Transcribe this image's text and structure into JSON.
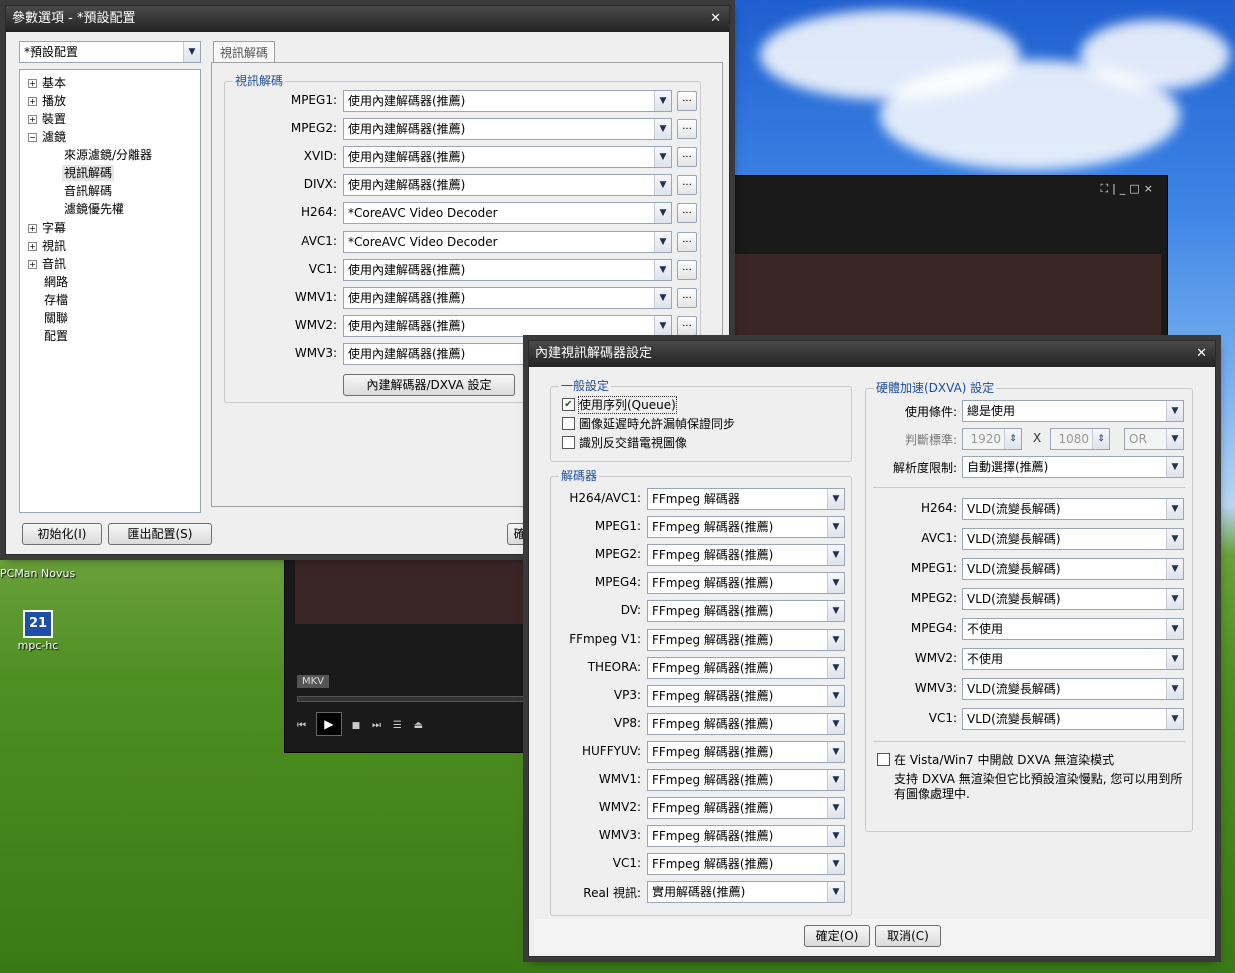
{
  "desktop": {
    "icons": [
      {
        "label": "PCMan Novus"
      },
      {
        "label": "mpc-hc"
      }
    ]
  },
  "options": {
    "title": "參數選項 - *預設配置",
    "profile": "*預設配置",
    "tree": [
      {
        "label": "基本",
        "expander": "+"
      },
      {
        "label": "播放",
        "expander": "+"
      },
      {
        "label": "裝置",
        "expander": "+"
      },
      {
        "label": "濾鏡",
        "expander": "−"
      },
      {
        "label": "來源濾鏡/分離器"
      },
      {
        "label": "視訊解碼"
      },
      {
        "label": "音訊解碼"
      },
      {
        "label": "濾鏡優先權"
      },
      {
        "label": "字幕",
        "expander": "+"
      },
      {
        "label": "視訊",
        "expander": "+"
      },
      {
        "label": "音訊",
        "expander": "+"
      },
      {
        "label": "網路"
      },
      {
        "label": "存檔"
      },
      {
        "label": "關聯"
      },
      {
        "label": "配置"
      }
    ],
    "tab": "視訊解碼",
    "group_title": "視訊解碼",
    "codecs": [
      {
        "label": "MPEG1:",
        "value": "使用內建解碼器(推薦)"
      },
      {
        "label": "MPEG2:",
        "value": "使用內建解碼器(推薦)"
      },
      {
        "label": "XVID:",
        "value": "使用內建解碼器(推薦)"
      },
      {
        "label": "DIVX:",
        "value": "使用內建解碼器(推薦)"
      },
      {
        "label": "H264:",
        "value": "*CoreAVC Video Decoder"
      },
      {
        "label": "AVC1:",
        "value": "*CoreAVC Video Decoder"
      },
      {
        "label": "VC1:",
        "value": "使用內建解碼器(推薦)"
      },
      {
        "label": "WMV1:",
        "value": "使用內建解碼器(推薦)"
      },
      {
        "label": "WMV2:",
        "value": "使用內建解碼器(推薦)"
      },
      {
        "label": "WMV3:",
        "value": "使用內建解碼器(推薦)"
      }
    ],
    "dots": "...",
    "dxva_button": "內建解碼器/DXVA 設定",
    "init_button": "初始化(I)",
    "export_button": "匯出配置(S)",
    "ok_button_partial": "確"
  },
  "player": {
    "format": "MKV",
    "controls": [
      "⏮",
      "▶",
      "■",
      "⏭",
      "☰",
      "⏏"
    ],
    "window_buttons": [
      "⛶",
      "|",
      "_",
      "□",
      "×"
    ]
  },
  "dialog": {
    "title": "內建視訊解碼器設定",
    "general_title": "一般設定",
    "checks": [
      {
        "label": "使用序列(Queue)",
        "checked": true
      },
      {
        "label": "圖像延遲時允許漏幀保證同步",
        "checked": false
      },
      {
        "label": "識別反交錯電視圖像",
        "checked": false
      }
    ],
    "decoders_title": "解碼器",
    "decoders": [
      {
        "label": "H264/AVC1:",
        "value": "FFmpeg 解碼器"
      },
      {
        "label": "MPEG1:",
        "value": "FFmpeg 解碼器(推薦)"
      },
      {
        "label": "MPEG2:",
        "value": "FFmpeg 解碼器(推薦)"
      },
      {
        "label": "MPEG4:",
        "value": "FFmpeg 解碼器(推薦)"
      },
      {
        "label": "DV:",
        "value": "FFmpeg 解碼器(推薦)"
      },
      {
        "label": "FFmpeg V1:",
        "value": "FFmpeg 解碼器(推薦)"
      },
      {
        "label": "THEORA:",
        "value": "FFmpeg 解碼器(推薦)"
      },
      {
        "label": "VP3:",
        "value": "FFmpeg 解碼器(推薦)"
      },
      {
        "label": "VP8:",
        "value": "FFmpeg 解碼器(推薦)"
      },
      {
        "label": "HUFFYUV:",
        "value": "FFmpeg 解碼器(推薦)"
      },
      {
        "label": "WMV1:",
        "value": "FFmpeg 解碼器(推薦)"
      },
      {
        "label": "WMV2:",
        "value": "FFmpeg 解碼器(推薦)"
      },
      {
        "label": "WMV3:",
        "value": "FFmpeg 解碼器(推薦)"
      },
      {
        "label": "VC1:",
        "value": "FFmpeg 解碼器(推薦)"
      },
      {
        "label": "Real 視訊:",
        "value": "實用解碼器(推薦)"
      }
    ],
    "hw_title": "硬體加速(DXVA) 設定",
    "usage_label": "使用條件:",
    "usage_value": "總是使用",
    "criteria_label": "判斷標準:",
    "width": "1920",
    "x_label": "X",
    "height": "1080",
    "op": "OR",
    "res_label": "解析度限制:",
    "res_value": "自動選擇(推薦)",
    "hw": [
      {
        "label": "H264:",
        "value": "VLD(流變長解碼)"
      },
      {
        "label": "AVC1:",
        "value": "VLD(流變長解碼)"
      },
      {
        "label": "MPEG1:",
        "value": "VLD(流變長解碼)"
      },
      {
        "label": "MPEG2:",
        "value": "VLD(流變長解碼)"
      },
      {
        "label": "MPEG4:",
        "value": "不使用"
      },
      {
        "label": "WMV2:",
        "value": "不使用"
      },
      {
        "label": "WMV3:",
        "value": "VLD(流變長解碼)"
      },
      {
        "label": "VC1:",
        "value": "VLD(流變長解碼)"
      }
    ],
    "vista_label": "在 Vista/Win7 中開啟 DXVA 無渲染模式",
    "vista_desc": "支持 DXVA 無渲染但它比預設渲染慢點, 您可以用到所有圖像處理中.",
    "ok": "確定(O)",
    "cancel": "取消(C)"
  }
}
